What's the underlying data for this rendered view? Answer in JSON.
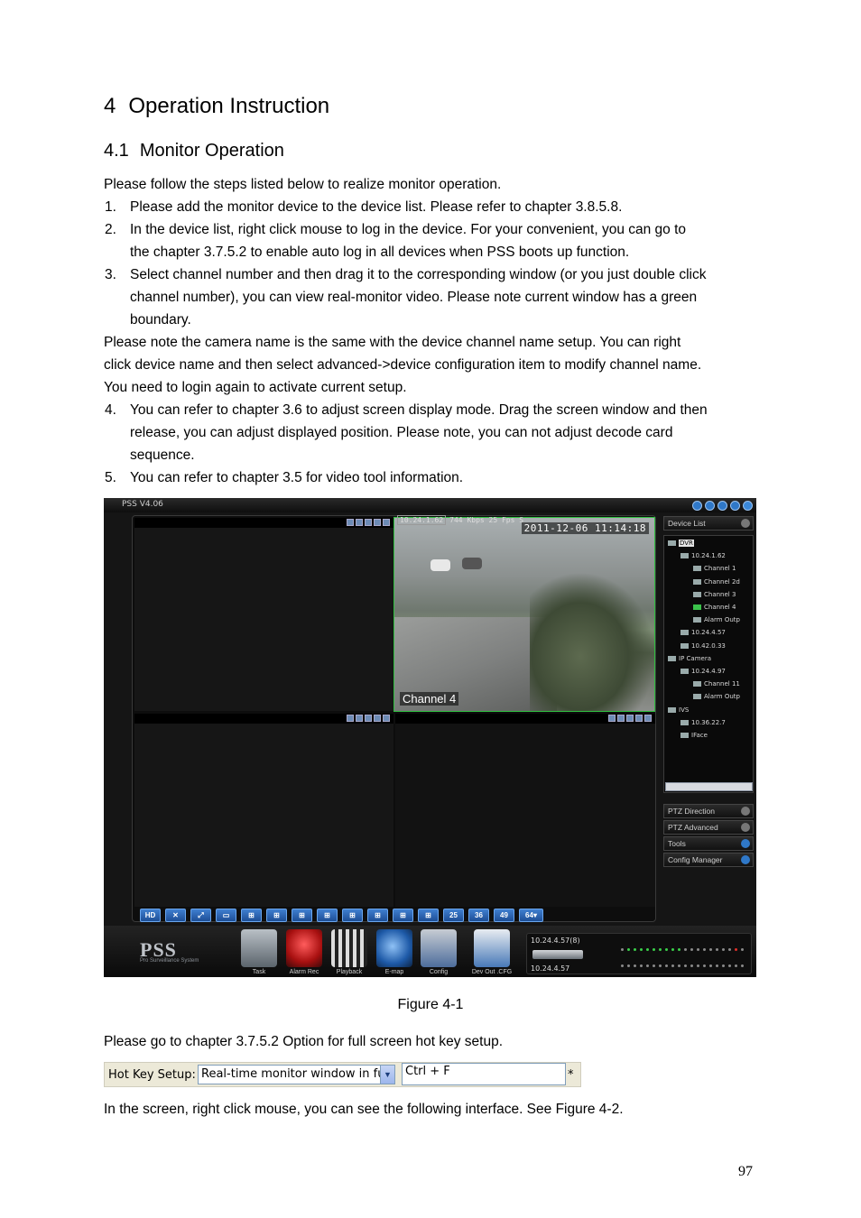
{
  "heading": {
    "number": "4",
    "title": "Operation Instruction"
  },
  "subheading": {
    "number": "4.1",
    "title": "Monitor Operation"
  },
  "intro": "Please follow the steps listed below to realize monitor operation.",
  "steps": [
    {
      "num": "1.",
      "lines": [
        "Please add the monitor device to the device list. Please refer to chapter 3.8.5.8."
      ]
    },
    {
      "num": "2.",
      "lines": [
        "In the device list, right click mouse to log in the device. For your convenient, you can go to",
        "the chapter 3.7.5.2 to enable auto log in all devices when PSS boots up function."
      ]
    },
    {
      "num": "3.",
      "lines": [
        "Select channel number and then drag it to the corresponding window (or you just double click",
        "channel number), you can view real-monitor video. Please note current window has a green",
        "boundary."
      ]
    }
  ],
  "note_lines": [
    "Please note the camera name is the same with the device channel name setup.  You can right",
    "click device name and then select advanced->device configuration item to modify channel name.",
    "You need to login again to activate current setup."
  ],
  "steps2": [
    {
      "num": "4.",
      "lines": [
        "You can refer to chapter 3.6 to adjust screen display mode. Drag the screen window and then",
        "release, you can adjust displayed position. Please note, you can not adjust decode card",
        "sequence."
      ]
    },
    {
      "num": "5.",
      "lines": [
        "You can refer to chapter 3.5 for video tool information."
      ]
    }
  ],
  "screenshot": {
    "title": "PSS  V4.06",
    "cam_header": {
      "ip": "10.24.1.62",
      "rate": "744 Kbps 25 Fps S"
    },
    "timestamp": "2011-12-06  11:14:18",
    "channel_label": "Channel 4",
    "toolbar_buttons": [
      "HD",
      "",
      "",
      "",
      "",
      "",
      "",
      "",
      "",
      "",
      "",
      "",
      "25",
      "36",
      "49",
      "64"
    ],
    "panels": {
      "device_list": "Device List",
      "ptz_direction": "PTZ Direction",
      "ptz_advanced": "PTZ Advanced",
      "tools": "Tools",
      "config_manager": "Config Manager"
    },
    "tree": [
      {
        "label": "DVR",
        "indent": 0,
        "selected": true
      },
      {
        "label": "10.24.1.62",
        "indent": 1
      },
      {
        "label": "Channel 1",
        "indent": 2
      },
      {
        "label": "Channel 2d",
        "indent": 2
      },
      {
        "label": "Channel 3",
        "indent": 2
      },
      {
        "label": "Channel 4",
        "indent": 2,
        "active": true
      },
      {
        "label": "Alarm Outp",
        "indent": 2
      },
      {
        "label": "10.24.4.57",
        "indent": 1
      },
      {
        "label": "10.42.0.33",
        "indent": 1
      },
      {
        "label": "IP Camera",
        "indent": 0
      },
      {
        "label": "10.24.4.97",
        "indent": 1
      },
      {
        "label": "Channel 11",
        "indent": 2
      },
      {
        "label": "Alarm Outp",
        "indent": 2
      },
      {
        "label": "IVS",
        "indent": 0
      },
      {
        "label": "10.36.22.7",
        "indent": 1
      },
      {
        "label": "IFace",
        "indent": 1
      }
    ],
    "logo": "PSS",
    "logo_sub": "Pro Surveillance System",
    "bottom_buttons": [
      "Task",
      "Alarm Rec",
      "Playback",
      "E-map",
      "Config",
      "Dev Out .CFG"
    ],
    "device_status": {
      "top": "10.24.4.57(8)",
      "bottom": "10.24.4.57"
    },
    "colors": {
      "active_border": "#30c040",
      "button_blue": "#2f6fc0"
    }
  },
  "caption": "Figure 4-1",
  "hotkey_intro": "Please go to chapter 3.7.5.2 Option for full screen hot key setup.",
  "hotkey": {
    "label": "Hot Key Setup:",
    "selected": "Real-time monitor window in full sc",
    "value": "Ctrl + F",
    "marker": "*"
  },
  "closing": "In the screen, right click mouse, you can see the following interface. See Figure 4-2.",
  "page_number": "97"
}
